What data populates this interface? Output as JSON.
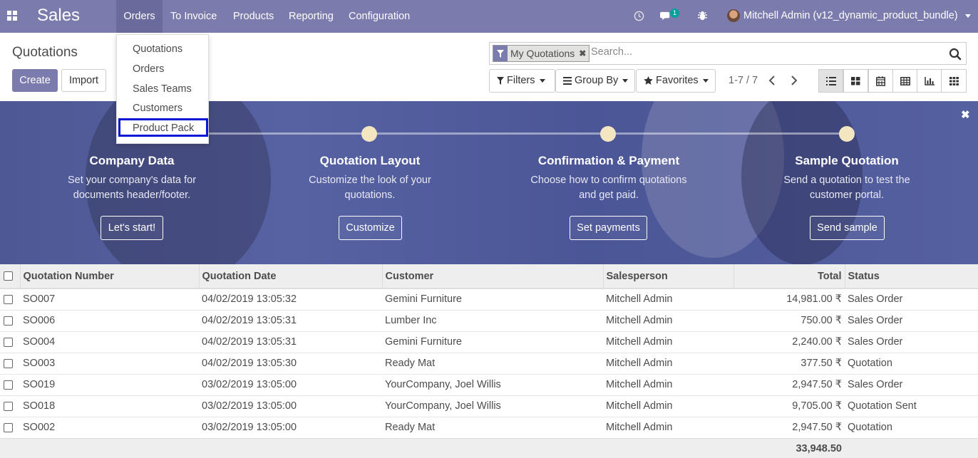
{
  "navbar": {
    "brand": "Sales",
    "menu": [
      "Orders",
      "To Invoice",
      "Products",
      "Reporting",
      "Configuration"
    ],
    "message_count": "1",
    "user": "Mitchell Admin (v12_dynamic_product_bundle)"
  },
  "orders_menu": {
    "items": [
      "Quotations",
      "Orders",
      "Sales Teams",
      "Customers",
      "Product Pack"
    ],
    "highlighted": "Product Pack"
  },
  "control": {
    "breadcrumb": "Quotations",
    "create_label": "Create",
    "import_label": "Import",
    "facet_label": "My Quotations",
    "search_placeholder": "Search...",
    "filters_label": "Filters",
    "groupby_label": "Group By",
    "favorites_label": "Favorites",
    "pager": "1-7 / 7",
    "views": [
      "list-view-icon",
      "kanban-view-icon",
      "calendar-view-icon",
      "pivot-view-icon",
      "graph-view-icon",
      "activity-view-icon"
    ],
    "active_view": "list-view-icon"
  },
  "onboarding": {
    "steps": [
      {
        "title": "Company Data",
        "desc1": "Set your company's data for",
        "desc2": "documents header/footer.",
        "button": "Let's start!"
      },
      {
        "title": "Quotation Layout",
        "desc1": "Customize the look of your",
        "desc2": "quotations.",
        "button": "Customize"
      },
      {
        "title": "Confirmation & Payment",
        "desc1": "Choose how to confirm quotations",
        "desc2": "and get paid.",
        "button": "Set payments"
      },
      {
        "title": "Sample Quotation",
        "desc1": "Send a quotation to test the",
        "desc2": "customer portal.",
        "button": "Send sample"
      }
    ],
    "dot_color": "#f5e6c2"
  },
  "table": {
    "columns": [
      "Quotation Number",
      "Quotation Date",
      "Customer",
      "Salesperson",
      "Total",
      "Status"
    ],
    "rows": [
      [
        "SO007",
        "04/02/2019 13:05:32",
        "Gemini Furniture",
        "Mitchell Admin",
        "14,981.00 ₹",
        "Sales Order"
      ],
      [
        "SO006",
        "04/02/2019 13:05:31",
        "Lumber Inc",
        "Mitchell Admin",
        "750.00 ₹",
        "Sales Order"
      ],
      [
        "SO004",
        "04/02/2019 13:05:31",
        "Gemini Furniture",
        "Mitchell Admin",
        "2,240.00 ₹",
        "Sales Order"
      ],
      [
        "SO003",
        "04/02/2019 13:05:30",
        "Ready Mat",
        "Mitchell Admin",
        "377.50 ₹",
        "Quotation"
      ],
      [
        "SO019",
        "03/02/2019 13:05:00",
        "YourCompany, Joel Willis",
        "Mitchell Admin",
        "2,947.50 ₹",
        "Sales Order"
      ],
      [
        "SO018",
        "03/02/2019 13:05:00",
        "YourCompany, Joel Willis",
        "Mitchell Admin",
        "9,705.00 ₹",
        "Quotation Sent"
      ],
      [
        "SO002",
        "03/02/2019 13:05:00",
        "Ready Mat",
        "Mitchell Admin",
        "2,947.50 ₹",
        "Quotation"
      ]
    ],
    "footer_total": "33,948.50"
  },
  "colors": {
    "brand": "#7c7bad",
    "highlight_border": "#0a18d6"
  }
}
